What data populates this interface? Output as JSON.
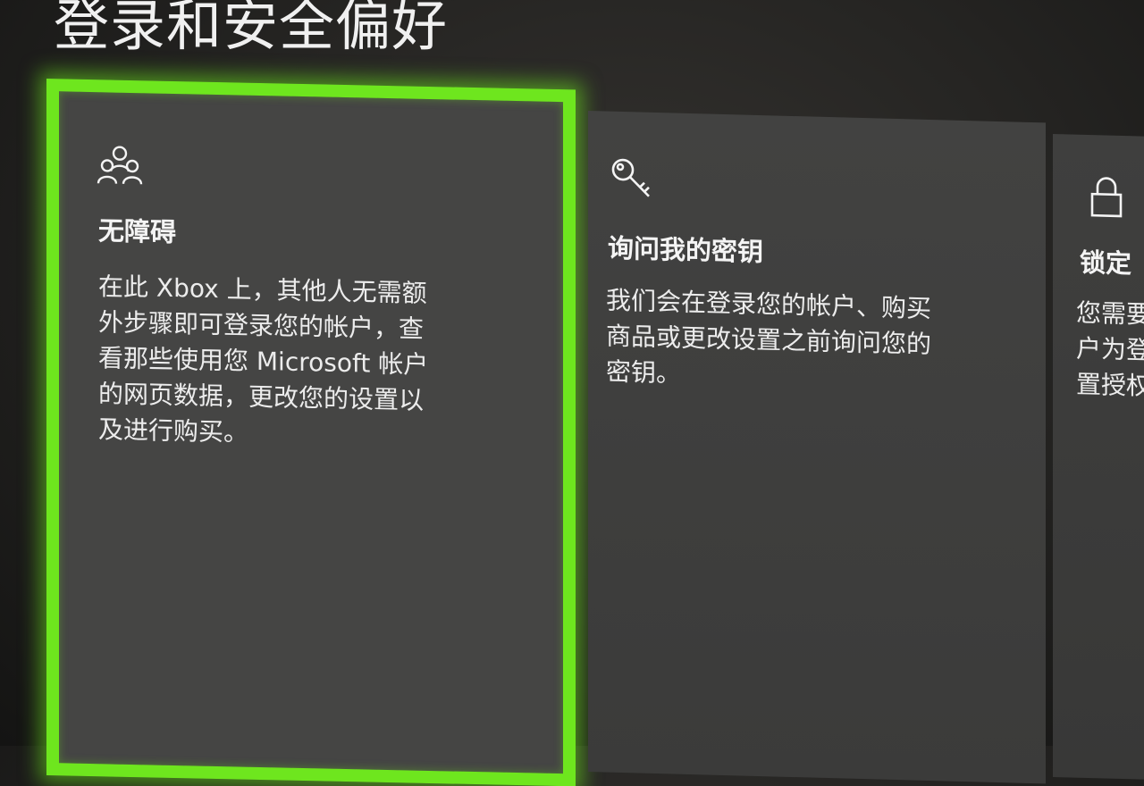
{
  "header": {
    "title": "登录和安全偏好"
  },
  "tiles": [
    {
      "icon": "people-icon",
      "heading": "无障碍",
      "description": "在此 Xbox 上，其他人无需额\n外步骤即可登录您的帐户，查\n看那些使用您 Microsoft 帐户\n的网页数据，更改您的设置以\n及进行购买。",
      "selected": true
    },
    {
      "icon": "key-icon",
      "heading": "询问我的密钥",
      "description": "我们会在登录您的帐户、购买\n商品或更改设置之前询问您的\n密钥。",
      "selected": false
    },
    {
      "icon": "lock-icon",
      "heading": "锁定",
      "description": "您需要\n户为登\n置授权",
      "selected": false
    }
  ],
  "colors": {
    "focus_border": "#6ee61e",
    "tile_background": "#434342",
    "text": "#f2f2f2"
  }
}
